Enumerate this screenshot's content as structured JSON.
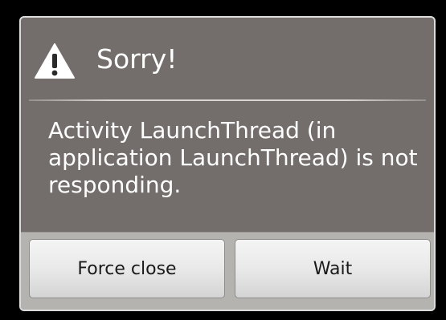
{
  "dialog": {
    "icon": "warning-icon",
    "title": "Sorry!",
    "message": "Activity LaunchThread (in application LaunchThread) is not responding.",
    "buttons": {
      "force_close": "Force close",
      "wait": "Wait"
    }
  },
  "colors": {
    "dialog_background": "#736e6b",
    "button_bar": "#b5b3b0",
    "warning_icon": "#ffffff"
  }
}
